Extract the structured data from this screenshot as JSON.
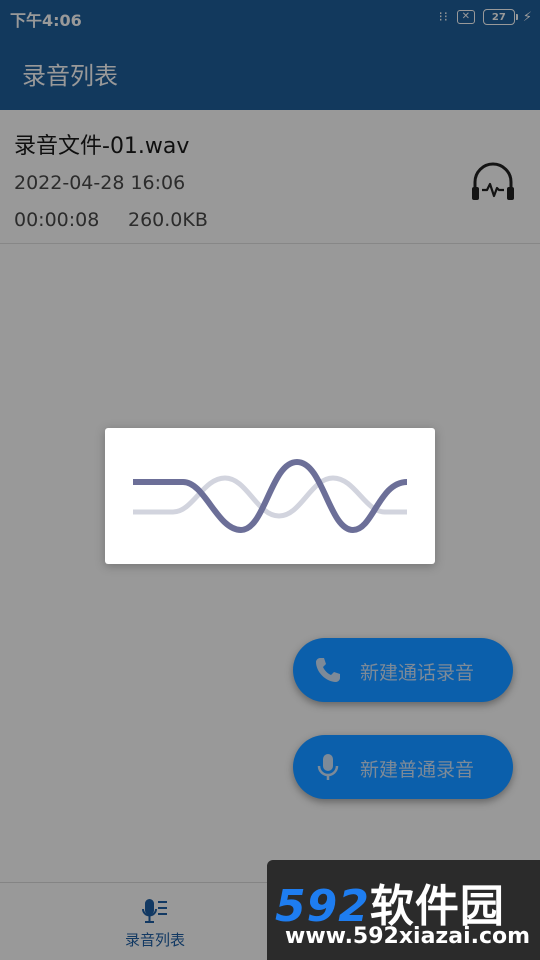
{
  "status_bar": {
    "time": "下午4:06",
    "signal_dots": "⁝⁝",
    "sim_icon_glyph": "✕",
    "battery_level": "27",
    "charging_glyph": "⚡"
  },
  "app_bar": {
    "title": "录音列表",
    "color": "#1f5f9c"
  },
  "recordings": [
    {
      "name": "录音文件-01.wav",
      "date": "2022-04-28 16:06",
      "duration": "00:00:08",
      "size": "260.0KB",
      "action_icon": "headphones-icon"
    }
  ],
  "fabs": {
    "call_label": "新建通话录音",
    "call_icon": "phone-icon",
    "record_label": "新建普通录音",
    "record_icon": "microphone-icon",
    "color": "#0b5fab"
  },
  "bottom_nav": {
    "items": [
      {
        "label": "录音列表",
        "icon": "recording-list-icon",
        "active": true
      }
    ]
  },
  "loading_dialog": {
    "icon": "waveform-loading-icon"
  },
  "watermark": {
    "logo_digits": "592",
    "logo_text": "软件园",
    "url": "www.592xiazai.com"
  }
}
